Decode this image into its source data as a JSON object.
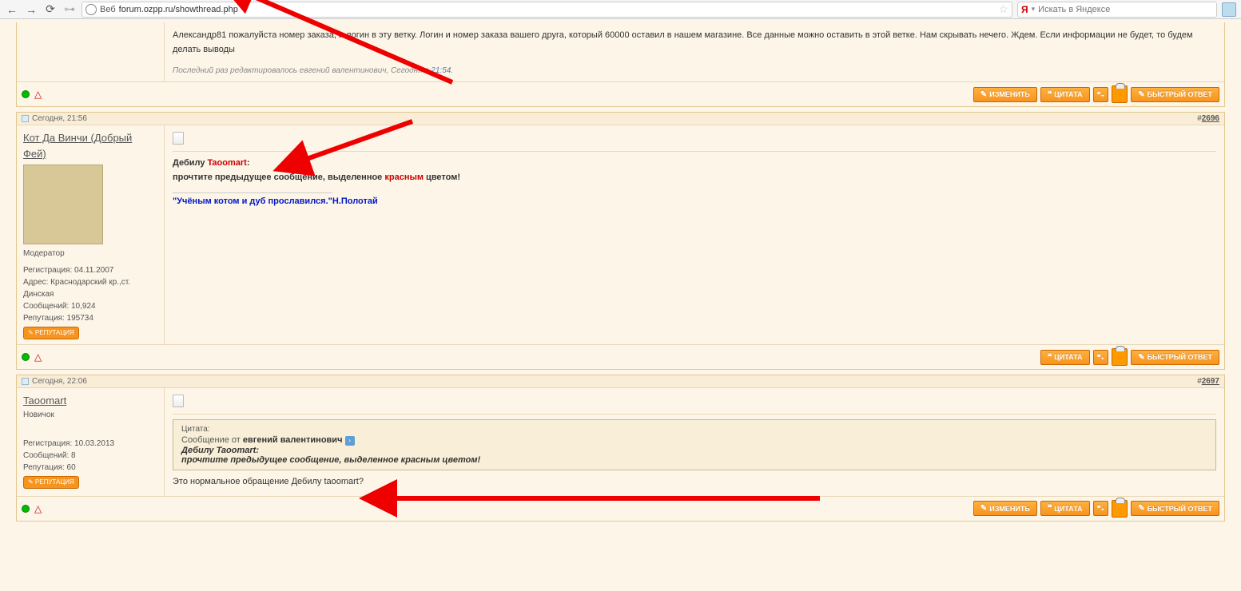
{
  "toolbar": {
    "url_prefix": "Веб",
    "url": "forum.ozpp.ru/showthread.php",
    "yandex_placeholder": "Искать в Яндексе"
  },
  "post1": {
    "msg": "Александр81 пожалуйста номер заказа, и логин в эту ветку. Логин и номер заказа вашего друга, который 60000 оставил в нашем магазине. Все данные можно оставить в этой ветке. Нам скрывать нечего. Ждем. Если информации не будет, то будем делать выводы",
    "edit_prefix": "Последний раз редактировалось евгений валентинович, Сегодня в ",
    "edit_time": "21:54",
    "edit_suffix": "."
  },
  "post2": {
    "timestamp": "Сегодня, 21:56",
    "permalink_hash": "#",
    "permalink_num": "2696",
    "author": "Кот Да Винчи (Добрый Фей)",
    "role": "Модератор",
    "reg_label": "Регистрация: 04.11.2007",
    "addr_label": "Адрес: Краснодарский кр.,ст. Динская",
    "msgs_label": "Сообщений: 10,924",
    "rep_label": "Репутация: 195734",
    "rep_badge": "✎ РЕПУТАЦИЯ",
    "line1_a": "Дебилу ",
    "line1_red": "Taoomart",
    "line1_b": ":",
    "line2_a": "прочтите предыдущее сообщение, выделенное ",
    "line2_red": "красным",
    "line2_b": " цветом!",
    "sig": "\"Учёным котом и дуб прославился.\"Н.Полотай"
  },
  "post3": {
    "timestamp": "Сегодня, 22:06",
    "permalink_hash": "#",
    "permalink_num": "2697",
    "author": "Taoomart",
    "role": "Новичок",
    "reg_label": "Регистрация: 10.03.2013",
    "msgs_label": "Сообщений: 8",
    "rep_label": "Репутация: 60",
    "rep_badge": "✎ РЕПУТАЦИЯ",
    "quote_hdr": "Цитата:",
    "quote_from_a": "Сообщение от ",
    "quote_from_b": "евгений валентинович",
    "q_line1_a": "Дебилу ",
    "q_line1_red": "Taoomart",
    "q_line1_b": ":",
    "q_line2_a": "прочтите предыдущее сообщение, выделенное ",
    "q_line2_red": "красным",
    "q_line2_b": " цветом!",
    "reply": "Это нормальное обращение Дебилу taoomart?"
  },
  "buttons": {
    "edit": "ИЗМЕНИТЬ",
    "quote": "ЦИТАТА",
    "multi": "❝₊",
    "fast": "БЫСТРЫЙ ОТВЕТ"
  }
}
